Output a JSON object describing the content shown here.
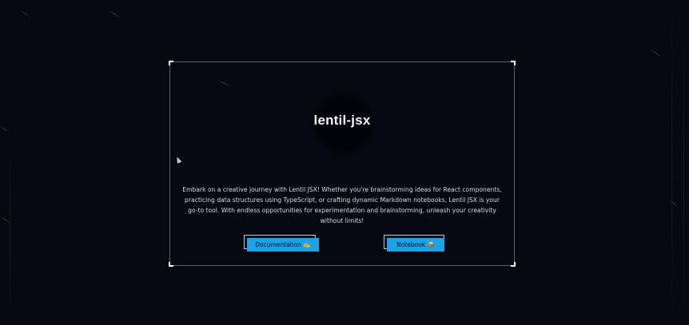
{
  "hero": {
    "title": "lentil-jsx",
    "description": "Embark on a creative journey with Lentil JSX! Whether you're brainstorming ideas for React components, practicing data structures using TypeScript, or crafting dynamic Markdown notebooks, Lentil JSX is your go-to tool. With endless opportunities for experimentation and brainstorming, unleash your creativity without limits!"
  },
  "buttons": {
    "documentation_label": "Documentation ✍️",
    "notebook_label": "Notebook 📦"
  },
  "colors": {
    "background": "#070912",
    "accent": "#1aa3e6",
    "frame": "#c8cdda"
  }
}
